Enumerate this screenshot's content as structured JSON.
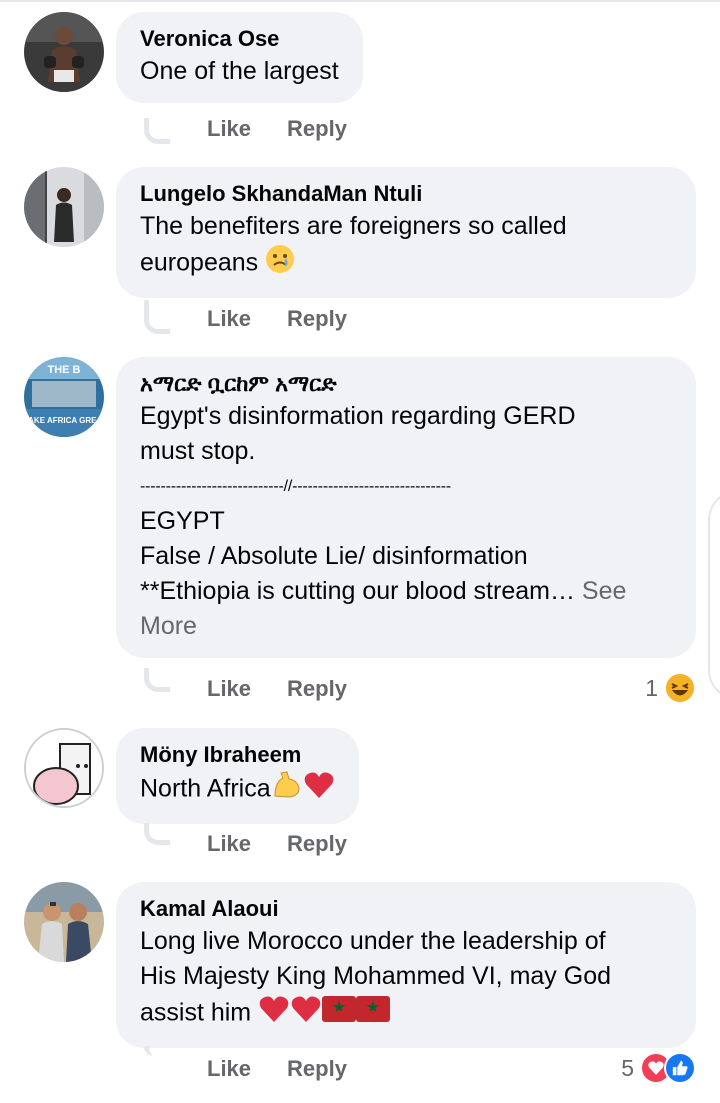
{
  "comments": [
    {
      "name": "Veronica Ose",
      "text_lines": [
        "One of the largest"
      ],
      "like_label": "Like",
      "reply_label": "Reply"
    },
    {
      "name": "Lungelo SkhandaMan Ntuli",
      "text_lines": [
        "The benefiters are foreigners so called",
        "europeans"
      ],
      "like_label": "Like",
      "reply_label": "Reply"
    },
    {
      "name": "አማርድ ቧርከም አማርድ",
      "avatar_text_top": "THE B",
      "avatar_text_bottom": "MAKE AFRICA GREAT",
      "text_lines": [
        "Egypt's disinformation regarding GERD",
        "must stop.",
        "----------------------------//-------------------------------",
        "EGYPT",
        "False / Absolute Lie/ disinformation",
        "**Ethiopia is cutting our blood stream…"
      ],
      "see_more_a": "See",
      "see_more_b": "More",
      "like_label": "Like",
      "reply_label": "Reply",
      "reaction_count": "1"
    },
    {
      "name": "Möny Ibraheem",
      "text_lines": [
        "North Africa"
      ],
      "like_label": "Like",
      "reply_label": "Reply"
    },
    {
      "name": "Kamal Alaoui",
      "text_lines": [
        "Long live Morocco under the leadership of",
        "His Majesty King Mohammed VI, may God",
        "assist him"
      ],
      "like_label": "Like",
      "reply_label": "Reply",
      "reaction_count": "5"
    }
  ],
  "icons": {
    "sad": "sad-face-icon",
    "haha": "haha-reaction-icon",
    "flexed": "flexed-biceps-icon",
    "heart": "red-heart-icon",
    "flag": "morocco-flag-icon",
    "love": "love-reaction-icon",
    "like": "like-reaction-icon"
  },
  "colors": {
    "bubble": "#f0f2f5",
    "secondary_text": "#65676b",
    "love": "#f33e58",
    "like": "#1877f2",
    "haha": "#f7b125"
  }
}
